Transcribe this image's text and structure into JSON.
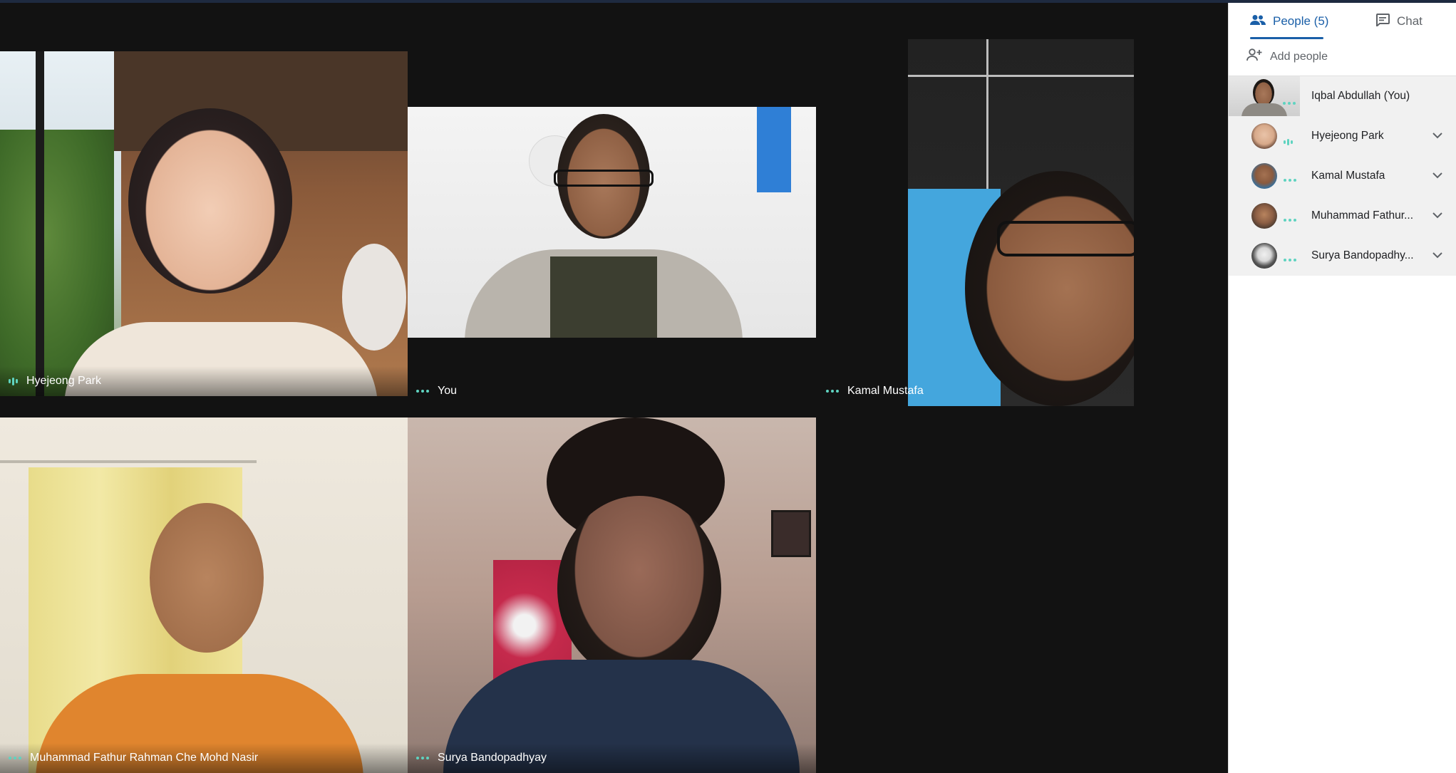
{
  "people_tab": {
    "label": "People (5)"
  },
  "chat_tab": {
    "label": "Chat"
  },
  "add_people": {
    "label": "Add people"
  },
  "participants_panel": [
    {
      "name": "Iqbal Abdullah (You)",
      "status": "dots"
    },
    {
      "name": "Hyejeong Park",
      "status": "speaking"
    },
    {
      "name": "Kamal Mustafa",
      "status": "dots"
    },
    {
      "name": "Muhammad Fathur...",
      "status": "dots"
    },
    {
      "name": "Surya Bandopadhy...",
      "status": "dots"
    }
  ],
  "tiles": [
    {
      "name": "Hyejeong Park",
      "status": "speaking"
    },
    {
      "name": "You",
      "status": "dots"
    },
    {
      "name": "Kamal Mustafa",
      "status": "dots"
    },
    {
      "name": "Muhammad Fathur Rahman Che Mohd Nasir",
      "status": "dots"
    },
    {
      "name": "Surya Bandopadhyay",
      "status": "dots"
    }
  ],
  "colors": {
    "accent": "#1a5fa8",
    "indicator": "#5fd3c0",
    "stage_bg": "#121212"
  }
}
